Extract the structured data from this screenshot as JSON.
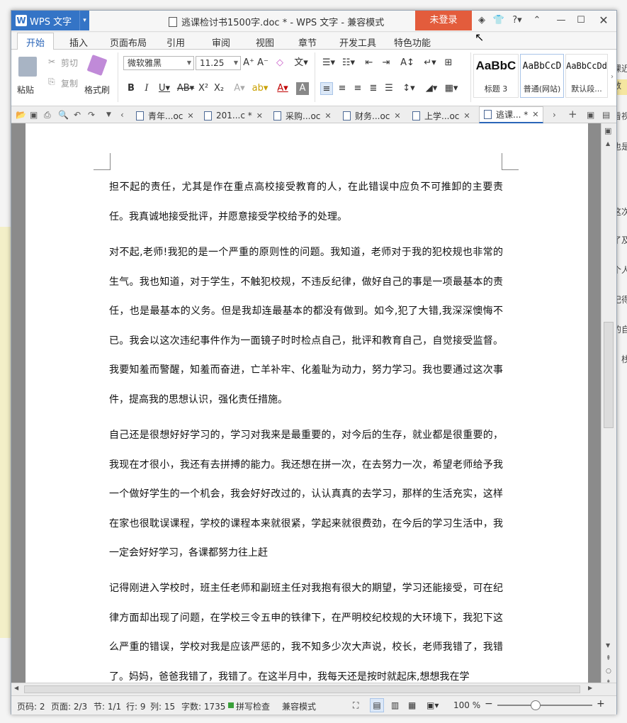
{
  "app": {
    "name": "WPS 文字",
    "dropdown_glyph": "▾",
    "doc_title": "逃课检讨书1500字.doc * - WPS 文字 - 兼容模式",
    "login_label": "未登录"
  },
  "ribbon_tabs": [
    "开始",
    "插入",
    "页面布局",
    "引用",
    "审阅",
    "视图",
    "章节",
    "开发工具",
    "特色功能"
  ],
  "clipboard": {
    "paste": "粘贴",
    "cut": "剪切",
    "copy": "复制",
    "format_painter": "格式刷"
  },
  "font": {
    "name": "微软雅黑",
    "size": "11.25"
  },
  "styles": [
    {
      "preview": "AaBbC",
      "label": "标题 3"
    },
    {
      "preview": "AaBbCcD",
      "label": "普通(网站)"
    },
    {
      "preview": "AaBbCcDd",
      "label": "默认段..."
    }
  ],
  "doc_tabs": [
    "青年...oc",
    "201...c *",
    "采购...oc",
    "财务...oc",
    "上学...oc",
    "逃课... *"
  ],
  "paragraphs": [
    "担不起的责任，尤其是作在重点高校接受教育的人，在此错误中应负不可推卸的主要责任。我真诚地接受批评，并愿意接受学校给予的处理。",
    "对不起,老师!我犯的是一个严重的原则性的问题。我知道，老师对于我的犯校规也非常的生气。我也知道，对于学生，不触犯校规，不违反纪律，做好自己的事是一项最基本的责任，也是最基本的义务。但是我却连最基本的都没有做到。如今,犯了大错,我深深懊悔不已。我会以这次违纪事件作为一面镜子时时检点自己，批评和教育自己，自觉接受监督。我要知羞而警醒，知羞而奋进，亡羊补牢、化羞耻为动力，努力学习。我也要通过这次事件，提高我的思想认识，强化责任措施。",
    "自己还是很想好好学习的，学习对我来是最重要的，对今后的生存，就业都是很重要的，我现在才很小，我还有去拼搏的能力。我还想在拼一次，在去努力一次，希望老师给予我一个做好学生的一个机会，我会好好改过的，认认真真的去学习，那样的生活充实，这样在家也很耽误课程，学校的课程本来就很紧，学起来就很费劲，在今后的学习生活中，我一定会好好学习，各课都努力往上赶",
    "记得刚进入学校时，班主任老师和副班主任对我抱有很大的期望，学习还能接受，可在纪律方面却出现了问题，在学校三令五申的铁律下，在严明校纪校规的大环境下，我犯下这么严重的错误，学校对我是应该严惩的，我不知多少次大声说，校长，老师我错了，我错了。妈妈，爸爸我错了，我错了。在这半月中，我每天还是按时就起床,想想我在学"
  ],
  "status": {
    "page_code": "页码: 2",
    "page": "页面: 2/3",
    "section": "节: 1/1",
    "line": "行: 9",
    "col": "列: 15",
    "words": "字数: 1735",
    "spell": "拼写检查",
    "mode": "兼容模式",
    "zoom": "100 %",
    "zoom_fraction": 0.4
  },
  "bg_window_fragments": [
    "课近",
    "数",
    "看视",
    "也是",
    "这次",
    "了及",
    "个人",
    "记得",
    "的自",
    "，栈"
  ],
  "colors": {
    "accent": "#3474c6",
    "login": "#e35c3c",
    "active_tab": "#2a65b8"
  }
}
